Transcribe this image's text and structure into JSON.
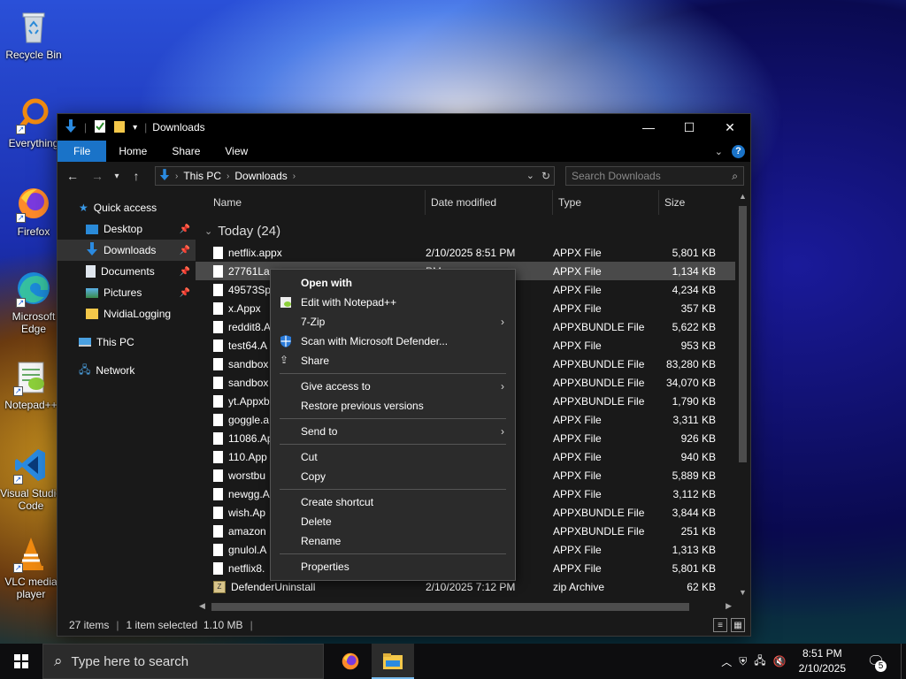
{
  "desktop": {
    "icons": [
      {
        "label": "Recycle Bin",
        "icon": "recycle-bin-icon"
      },
      {
        "label": "Everything",
        "icon": "everything-icon"
      },
      {
        "label": "Firefox",
        "icon": "firefox-icon"
      },
      {
        "label": "Microsoft Edge",
        "icon": "edge-icon"
      },
      {
        "label": "Notepad++",
        "icon": "notepadpp-icon"
      },
      {
        "label": "Visual Studio Code",
        "icon": "vscode-icon"
      },
      {
        "label": "VLC media player",
        "icon": "vlc-icon"
      }
    ]
  },
  "window": {
    "title": "Downloads",
    "controls": {
      "minimize": "—",
      "maximize": "☐",
      "close": "✕"
    },
    "ribbon_tabs": [
      "File",
      "Home",
      "Share",
      "View"
    ],
    "address": [
      "This PC",
      "Downloads"
    ],
    "search_placeholder": "Search Downloads",
    "nav": {
      "quick_access": "Quick access",
      "items": [
        "Desktop",
        "Downloads",
        "Documents",
        "Pictures",
        "NvidiaLogging"
      ],
      "this_pc": "This PC",
      "network": "Network"
    },
    "columns": [
      "Name",
      "Date modified",
      "Type",
      "Size"
    ],
    "group": "Today (24)",
    "files": [
      {
        "name": "netflix.appx",
        "date": "2/10/2025 8:51 PM",
        "type": "APPX File",
        "size": "5,801 KB"
      },
      {
        "name": "27761La",
        "date": "PM",
        "type": "APPX File",
        "size": "1,134 KB"
      },
      {
        "name": "49573Sp",
        "date": "PM",
        "type": "APPX File",
        "size": "4,234 KB"
      },
      {
        "name": "x.Appx",
        "date": "PM",
        "type": "APPX File",
        "size": "357 KB"
      },
      {
        "name": "reddit8.A",
        "date": "PM",
        "type": "APPXBUNDLE File",
        "size": "5,622 KB"
      },
      {
        "name": "test64.A",
        "date": "PM",
        "type": "APPX File",
        "size": "953 KB"
      },
      {
        "name": "sandbox",
        "date": "PM",
        "type": "APPXBUNDLE File",
        "size": "83,280 KB"
      },
      {
        "name": "sandbox",
        "date": "PM",
        "type": "APPXBUNDLE File",
        "size": "34,070 KB"
      },
      {
        "name": "yt.Appxb",
        "date": "PM",
        "type": "APPXBUNDLE File",
        "size": "1,790 KB"
      },
      {
        "name": "goggle.a",
        "date": "PM",
        "type": "APPX File",
        "size": "3,311 KB"
      },
      {
        "name": "11086.Ap",
        "date": "PM",
        "type": "APPX File",
        "size": "926 KB"
      },
      {
        "name": "110.App",
        "date": "PM",
        "type": "APPX File",
        "size": "940 KB"
      },
      {
        "name": "worstbu",
        "date": "PM",
        "type": "APPX File",
        "size": "5,889 KB"
      },
      {
        "name": "newgg.A",
        "date": "PM",
        "type": "APPX File",
        "size": "3,112 KB"
      },
      {
        "name": "wish.Ap",
        "date": "PM",
        "type": "APPXBUNDLE File",
        "size": "3,844 KB"
      },
      {
        "name": "amazon",
        "date": "PM",
        "type": "APPXBUNDLE File",
        "size": "251 KB"
      },
      {
        "name": "gnulol.A",
        "date": "PM",
        "type": "APPX File",
        "size": "1,313 KB"
      },
      {
        "name": "netflix8.",
        "date": "PM",
        "type": "APPX File",
        "size": "5,801 KB"
      },
      {
        "name": "DefenderUninstall",
        "date": "2/10/2025 7:12 PM",
        "type": "zip Archive",
        "size": "62 KB"
      }
    ],
    "status": {
      "items": "27 items",
      "selected": "1 item selected  1.10 MB"
    }
  },
  "context_menu": {
    "open_with": "Open with",
    "edit_notepad": "Edit with Notepad++",
    "seven_zip": "7-Zip",
    "scan_defender": "Scan with Microsoft Defender...",
    "share": "Share",
    "give_access": "Give access to",
    "restore": "Restore previous versions",
    "send_to": "Send to",
    "cut": "Cut",
    "copy": "Copy",
    "create_shortcut": "Create shortcut",
    "delete": "Delete",
    "rename": "Rename",
    "properties": "Properties"
  },
  "taskbar": {
    "search_placeholder": "Type here to search",
    "time": "8:51 PM",
    "date": "2/10/2025",
    "notifications": "5"
  },
  "colors": {
    "accent": "#1a73c8",
    "bg": "#191919",
    "menu": "#2b2b2b"
  }
}
